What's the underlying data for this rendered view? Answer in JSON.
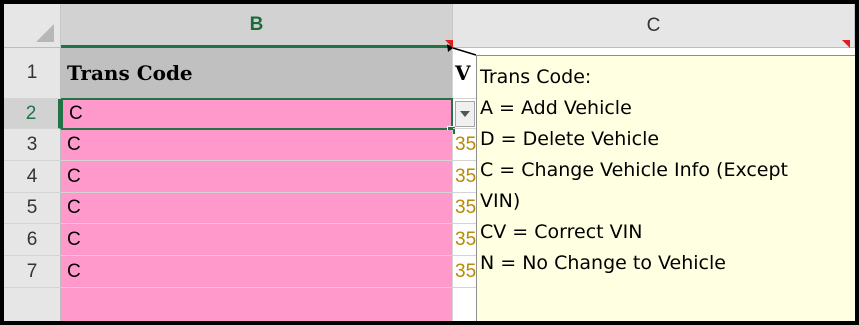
{
  "columns": {
    "b": "B",
    "c": "C"
  },
  "rows": [
    "1",
    "2",
    "3",
    "4",
    "5",
    "6",
    "7"
  ],
  "header_row": {
    "b": "Trans Code",
    "c": "V"
  },
  "data_rows": [
    {
      "b": "C",
      "c": ""
    },
    {
      "b": "C",
      "c": "35"
    },
    {
      "b": "C",
      "c": "35"
    },
    {
      "b": "C",
      "c": "35"
    },
    {
      "b": "C",
      "c": "35"
    },
    {
      "b": "C",
      "c": "35"
    }
  ],
  "comment": {
    "lines": [
      "Trans Code:",
      "A  = Add Vehicle",
      " D  = Delete Vehicle",
      " C  = Change Vehicle Info (Except",
      "VIN)",
      " CV = Correct VIN",
      " N = No Change to Vehicle"
    ]
  },
  "icons": {
    "dropdown": "chevron-down-icon"
  },
  "colors": {
    "accent": "#217346",
    "pink_fill": "#ff99cc",
    "comment_bg": "#ffffe1",
    "indicator": "#e21b1b"
  }
}
